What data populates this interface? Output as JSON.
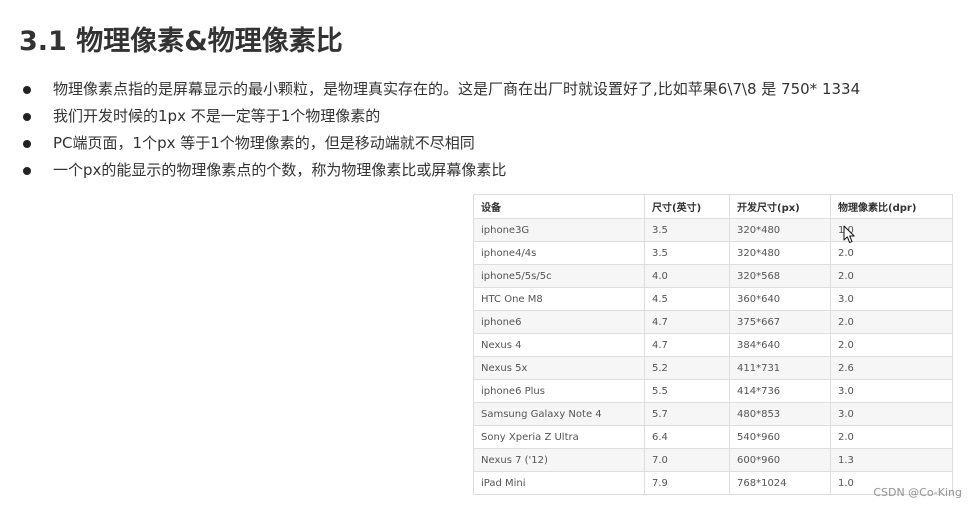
{
  "slide": {
    "heading": "3.1 物理像素&物理像素比",
    "bullets": [
      "物理像素点指的是屏幕显示的最小颗粒，是物理真实存在的。这是厂商在出厂时就设置好了,比如苹果6\\7\\8 是 750* 1334",
      "我们开发时候的1px 不是一定等于1个物理像素的",
      "PC端页面，1个px 等于1个物理像素的，但是移动端就不尽相同",
      "一个px的能显示的物理像素点的个数，称为物理像素比或屏幕像素比"
    ]
  },
  "table": {
    "headers": [
      "设备",
      "尺寸(英寸)",
      "开发尺寸(px)",
      "物理像素比(dpr)"
    ],
    "rows": [
      [
        "iphone3G",
        "3.5",
        "320*480",
        "1.0"
      ],
      [
        "iphone4/4s",
        "3.5",
        "320*480",
        "2.0"
      ],
      [
        "iphone5/5s/5c",
        "4.0",
        "320*568",
        "2.0"
      ],
      [
        "HTC One M8",
        "4.5",
        "360*640",
        "3.0"
      ],
      [
        "iphone6",
        "4.7",
        "375*667",
        "2.0"
      ],
      [
        "Nexus 4",
        "4.7",
        "384*640",
        "2.0"
      ],
      [
        "Nexus 5x",
        "5.2",
        "411*731",
        "2.6"
      ],
      [
        "iphone6 Plus",
        "5.5",
        "414*736",
        "3.0"
      ],
      [
        "Samsung Galaxy Note 4",
        "5.7",
        "480*853",
        "3.0"
      ],
      [
        "Sony Xperia Z Ultra",
        "6.4",
        "540*960",
        "2.0"
      ],
      [
        "Nexus 7 ('12)",
        "7.0",
        "600*960",
        "1.3"
      ],
      [
        "iPad Mini",
        "7.9",
        "768*1024",
        "1.0"
      ]
    ]
  },
  "watermark": "CSDN @Co-King",
  "icons": {
    "bullet": "bullet-dot-icon",
    "cursor": "mouse-cursor-icon"
  },
  "colors": {
    "text": "#333333",
    "cell_text": "#555555",
    "table_border": "#dddddd",
    "row_stripe": "#f6f6f6"
  }
}
